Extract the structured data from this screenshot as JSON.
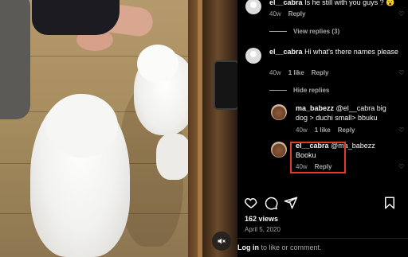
{
  "comments": [
    {
      "username": "el__cabra",
      "text": "Is he still with you guys ? 😮",
      "age": "40w",
      "reply_label": "Reply",
      "view_replies": "View replies (3)"
    },
    {
      "username": "el__cabra",
      "text": "Hi what's there names please",
      "age": "40w",
      "likes": "1 like",
      "reply_label": "Reply",
      "hide_replies": "Hide replies",
      "replies": [
        {
          "username": "ma_babezz",
          "text": "@el__cabra big dog > duchi small> bbuku",
          "age": "40w",
          "likes": "1 like",
          "reply_label": "Reply"
        },
        {
          "username": "el__cabra",
          "mention": "@ma_babezz",
          "text": "Booku",
          "age": "40w",
          "reply_label": "Reply"
        }
      ]
    }
  ],
  "post": {
    "views": "162 views",
    "date": "April 5, 2020",
    "login_link": "Log in",
    "login_rest": "to like or comment."
  },
  "icons": {
    "like": "heart-icon",
    "comment": "comment-icon",
    "share": "share-icon",
    "save": "bookmark-icon",
    "mute": "speaker-muted-icon"
  },
  "colors": {
    "highlight": "#e33a2a",
    "background": "#000000",
    "secondary_text": "#a8a8a8"
  }
}
